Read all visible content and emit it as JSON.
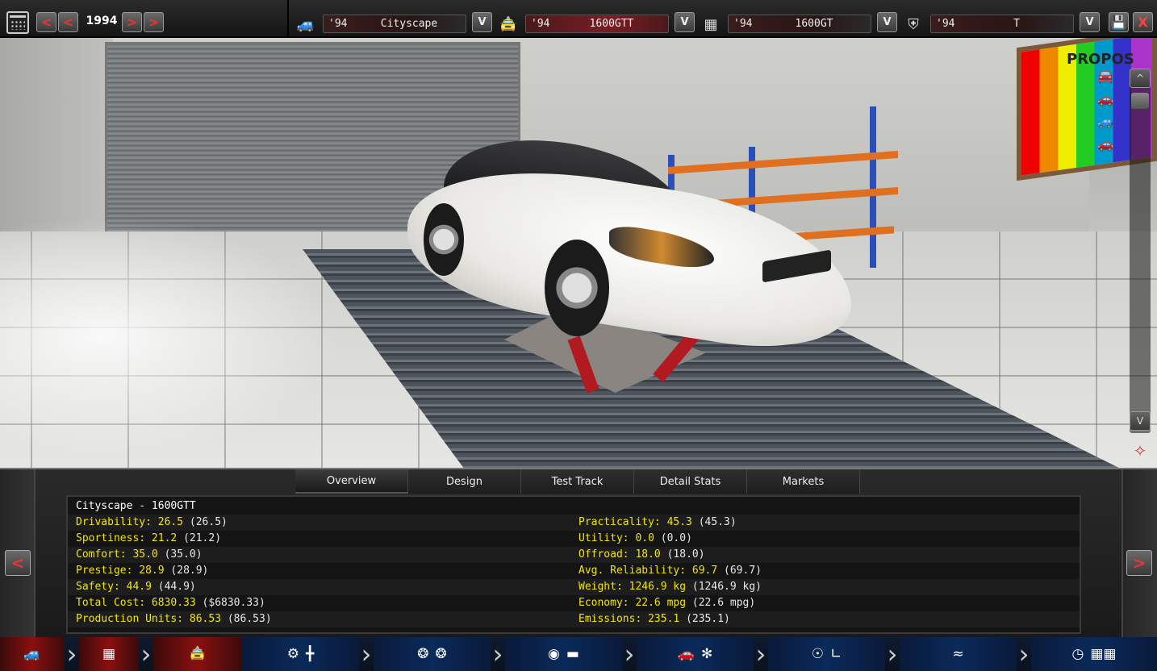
{
  "topbar": {
    "year": "1994",
    "prev_fast": "<",
    "prev": "<",
    "next": ">",
    "next_fast": ">",
    "dropdown_symbol": "V",
    "selectors": [
      {
        "year": "'94",
        "name": "Cityscape",
        "icon": "car-icon"
      },
      {
        "year": "'94",
        "name": "1600GTT",
        "icon": "car-trim-icon"
      },
      {
        "year": "'94",
        "name": "1600GT",
        "icon": "chassis-icon"
      },
      {
        "year": "'94",
        "name": "T",
        "icon": "engine-icon"
      }
    ],
    "save_icon": "save-icon",
    "close_label": "X"
  },
  "viewport": {
    "board_title": "PROPOS",
    "scroll_up": "^",
    "scroll_down": "V",
    "body_icons": [
      "coupe-icon",
      "sedan-icon",
      "hatch-icon",
      "sports-icon"
    ]
  },
  "panel": {
    "tabs": [
      "Overview",
      "Design",
      "Test Track",
      "Detail Stats",
      "Markets"
    ],
    "active_tab": "Overview",
    "model_title": "Cityscape - 1600GTT",
    "prev": "<",
    "next": ">",
    "left_stats": [
      {
        "key": "Drivability:",
        "value": "26.5",
        "paren": "(26.5)"
      },
      {
        "key": "Sportiness:",
        "value": "21.2",
        "paren": "(21.2)"
      },
      {
        "key": "Comfort:",
        "value": "35.0",
        "paren": "(35.0)"
      },
      {
        "key": "Prestige:",
        "value": "28.9",
        "paren": "(28.9)"
      },
      {
        "key": "Safety:",
        "value": "44.9",
        "paren": "(44.9)"
      },
      {
        "key": "Total Cost:",
        "value": "6830.33",
        "paren": "($6830.33)"
      },
      {
        "key": "Production Units:",
        "value": "86.53",
        "paren": "(86.53)"
      }
    ],
    "right_stats": [
      {
        "key": "Practicality:",
        "value": "45.3",
        "paren": "(45.3)"
      },
      {
        "key": "Utility:",
        "value": "0.0",
        "paren": "(0.0)"
      },
      {
        "key": "Offroad:",
        "value": "18.0",
        "paren": "(18.0)"
      },
      {
        "key": "Avg. Reliability:",
        "value": "69.7",
        "paren": "(69.7)"
      },
      {
        "key": "Weight:",
        "value": "1246.9 kg",
        "paren": "(1246.9 kg)"
      },
      {
        "key": "Economy:",
        "value": "22.6 mpg",
        "paren": "(22.6 mpg)"
      },
      {
        "key": "Emissions:",
        "value": "235.1",
        "paren": "(235.1)"
      }
    ]
  },
  "workflow": {
    "steps": [
      {
        "name": "car-model-step",
        "icons": [
          "car-icon"
        ]
      },
      {
        "name": "chassis-step",
        "icons": [
          "chassis-icon"
        ]
      },
      {
        "name": "trim-step",
        "icons": [
          "car-trim-icon"
        ]
      },
      {
        "name": "engine-gearbox-step",
        "icons": [
          "gear-icon",
          "gearbox-icon"
        ]
      },
      {
        "name": "wheels-step",
        "icons": [
          "wheel-icon",
          "wheel-icon"
        ]
      },
      {
        "name": "tyre-brake-step",
        "icons": [
          "brake-icon",
          "tyre-icon"
        ]
      },
      {
        "name": "body-aero-step",
        "icons": [
          "car-body-icon",
          "fan-icon"
        ]
      },
      {
        "name": "interior-step",
        "icons": [
          "steering-wheel-icon",
          "seat-icon"
        ]
      },
      {
        "name": "suspension-step",
        "icons": [
          "spring-icon"
        ]
      },
      {
        "name": "test-step",
        "icons": [
          "gauge-icon",
          "checkered-flag-icon"
        ]
      }
    ]
  }
}
